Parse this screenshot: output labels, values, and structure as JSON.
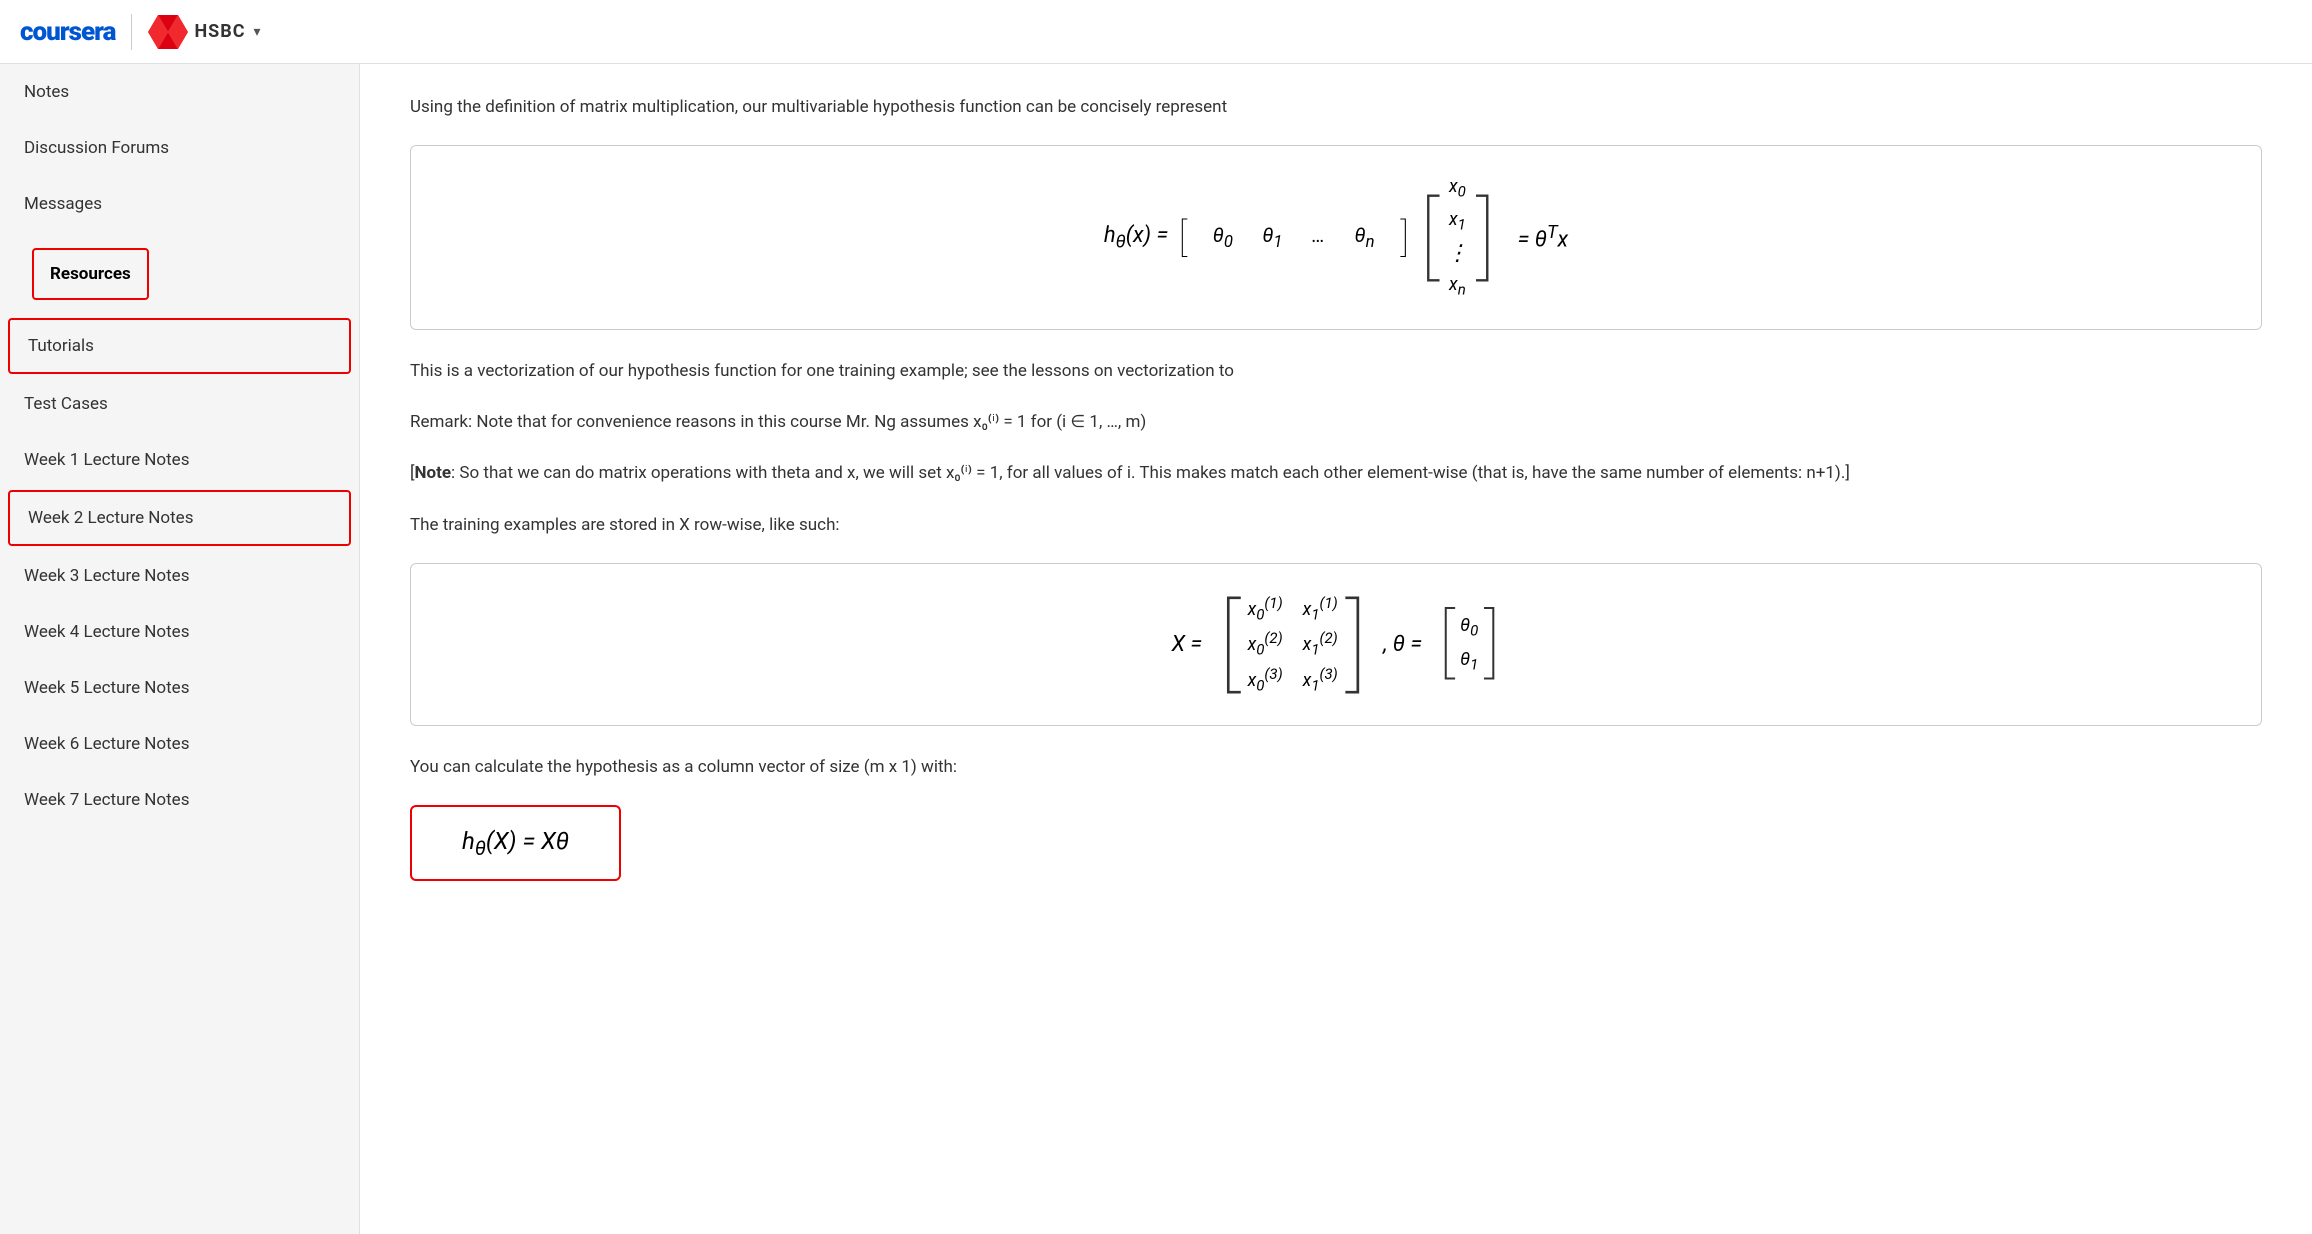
{
  "header": {
    "coursera_label": "coursera",
    "hsbc_label": "HSBC",
    "dropdown_label": "▾"
  },
  "sidebar": {
    "items": [
      {
        "id": "notes",
        "label": "Notes",
        "type": "plain"
      },
      {
        "id": "discussion-forums",
        "label": "Discussion Forums",
        "type": "plain"
      },
      {
        "id": "messages",
        "label": "Messages",
        "type": "plain"
      },
      {
        "id": "resources",
        "label": "Resources",
        "type": "section-header"
      },
      {
        "id": "tutorials",
        "label": "Tutorials",
        "type": "outlined"
      },
      {
        "id": "test-cases",
        "label": "Test Cases",
        "type": "plain"
      },
      {
        "id": "week1",
        "label": "Week 1 Lecture Notes",
        "type": "plain"
      },
      {
        "id": "week2",
        "label": "Week 2 Lecture Notes",
        "type": "week2-outlined"
      },
      {
        "id": "week3",
        "label": "Week 3 Lecture Notes",
        "type": "plain"
      },
      {
        "id": "week4",
        "label": "Week 4 Lecture Notes",
        "type": "plain"
      },
      {
        "id": "week5",
        "label": "Week 5 Lecture Notes",
        "type": "plain"
      },
      {
        "id": "week6",
        "label": "Week 6 Lecture Notes",
        "type": "plain"
      },
      {
        "id": "week7",
        "label": "Week 7 Lecture Notes",
        "type": "plain"
      }
    ]
  },
  "content": {
    "intro_text": "Using the definition of matrix multiplication, our multivariable hypothesis function can be concisely represent",
    "vectorization_text": "This is a vectorization of our hypothesis function for one training example; see the lessons on vectorization to",
    "remark_text": "Remark: Note that for convenience reasons in this course Mr. Ng assumes x₀⁽ⁱ⁾ = 1 for (i ∈ 1, …, m)",
    "note_bold": "Note",
    "note_text": ": So that we can do matrix operations with theta and x, we will set x₀⁽ⁱ⁾ = 1, for all values of i. This makes match each other element-wise (that is, have the same number of elements: n+1).]",
    "training_text": "The training examples are stored in X row-wise, like such:",
    "column_vector_text": "You can calculate the hypothesis as a column vector of size (m x 1) with:"
  }
}
